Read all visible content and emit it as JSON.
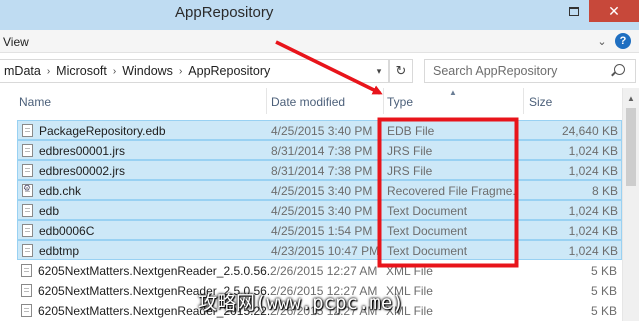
{
  "window": {
    "title": "AppRepository",
    "maximize_icon": "maximize-icon",
    "close_label": "✕"
  },
  "ribbon": {
    "view_label": "View",
    "collapse_icon": "chevron-down-icon",
    "help_icon": "help-icon",
    "help_label": "?"
  },
  "address": {
    "crumbs": [
      "mData",
      "Microsoft",
      "Windows",
      "AppRepository"
    ],
    "separator": "›",
    "dropdown": "▾",
    "refresh": "↻",
    "search_placeholder": "Search AppRepository"
  },
  "columns": {
    "name": "Name",
    "date": "Date modified",
    "type": "Type",
    "size": "Size"
  },
  "files": [
    {
      "name": "PackageRepository.edb",
      "date": "4/25/2015 3:40 PM",
      "type": "EDB File",
      "size": "24,640 KB",
      "selected": true,
      "icon": "file-icon"
    },
    {
      "name": "edbres00001.jrs",
      "date": "8/31/2014 7:38 PM",
      "type": "JRS File",
      "size": "1,024 KB",
      "selected": true,
      "icon": "file-icon"
    },
    {
      "name": "edbres00002.jrs",
      "date": "8/31/2014 7:38 PM",
      "type": "JRS File",
      "size": "1,024 KB",
      "selected": true,
      "icon": "file-icon"
    },
    {
      "name": "edb.chk",
      "date": "4/25/2015 3:40 PM",
      "type": "Recovered File Fragme...",
      "size": "8 KB",
      "selected": true,
      "icon": "settings-file-icon"
    },
    {
      "name": "edb",
      "date": "4/25/2015 3:40 PM",
      "type": "Text Document",
      "size": "1,024 KB",
      "selected": true,
      "icon": "file-icon"
    },
    {
      "name": "edb0006C",
      "date": "4/25/2015 1:54 PM",
      "type": "Text Document",
      "size": "1,024 KB",
      "selected": true,
      "icon": "file-icon"
    },
    {
      "name": "edbtmp",
      "date": "4/23/2015 10:47 PM",
      "type": "Text Document",
      "size": "1,024 KB",
      "selected": true,
      "icon": "file-icon"
    },
    {
      "name": "6205NextMatters.NextgenReader_2.5.0.56...",
      "date": "2/26/2015 12:27 AM",
      "type": "XML File",
      "size": "5 KB",
      "selected": false,
      "icon": "file-icon"
    },
    {
      "name": "6205NextMatters.NextgenReader_2.5.0.56...",
      "date": "2/26/2015 12:27 AM",
      "type": "XML File",
      "size": "5 KB",
      "selected": false,
      "icon": "file-icon"
    },
    {
      "name": "6205NextMatters.NextgenReader_2015.22...",
      "date": "2/26/2015 12:27 AM",
      "type": "XML File",
      "size": "5 KB",
      "selected": false,
      "icon": "file-icon"
    }
  ],
  "annotation": {
    "arrow_color": "#e8141b",
    "box_color": "#e8141b",
    "watermark": "攻略网(www.pcpc.me)"
  }
}
